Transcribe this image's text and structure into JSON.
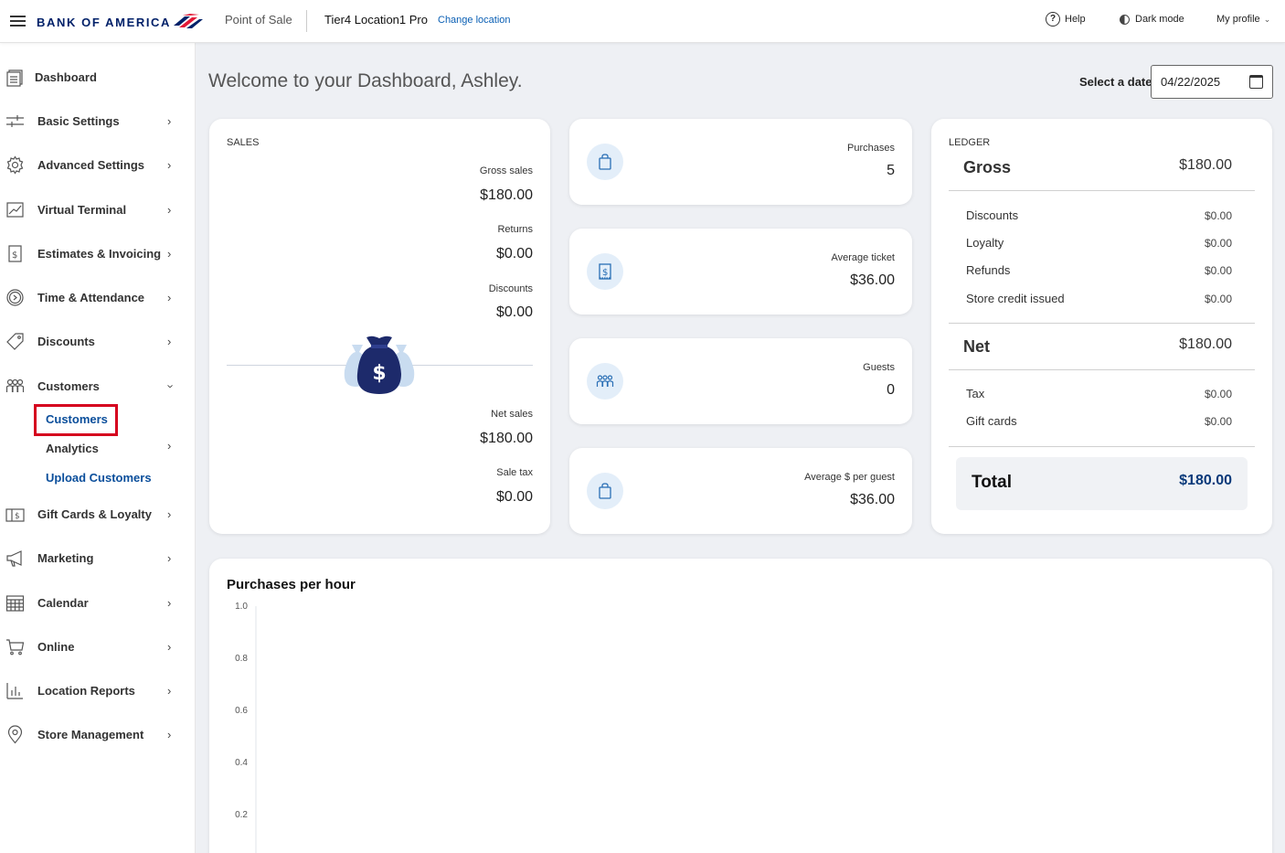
{
  "header": {
    "brand": "BANK OF AMERICA",
    "app_name": "Point of Sale",
    "location_name": "Tier4 Location1 Pro",
    "change_location": "Change location",
    "help": "Help",
    "dark_mode": "Dark mode",
    "my_profile": "My profile"
  },
  "sidebar": {
    "items": [
      {
        "label": "Dashboard",
        "icon": "dashboard-icon"
      },
      {
        "label": "Basic Settings",
        "icon": "sliders-icon"
      },
      {
        "label": "Advanced Settings",
        "icon": "gear-icon"
      },
      {
        "label": "Virtual Terminal",
        "icon": "terminal-icon"
      },
      {
        "label": "Estimates & Invoicing",
        "icon": "invoice-icon"
      },
      {
        "label": "Time & Attendance",
        "icon": "clock-icon"
      },
      {
        "label": "Discounts",
        "icon": "tag-icon"
      },
      {
        "label": "Customers",
        "icon": "people-icon"
      },
      {
        "label": "Gift Cards & Loyalty",
        "icon": "gift-card-icon"
      },
      {
        "label": "Marketing",
        "icon": "megaphone-icon"
      },
      {
        "label": "Calendar",
        "icon": "calendar-icon"
      },
      {
        "label": "Online",
        "icon": "cart-icon"
      },
      {
        "label": "Location Reports",
        "icon": "bar-chart-icon"
      },
      {
        "label": "Store Management",
        "icon": "location-pin-icon"
      }
    ],
    "customers_sub": {
      "customers": "Customers",
      "analytics": "Analytics",
      "upload_customers": "Upload Customers"
    }
  },
  "main": {
    "welcome": "Welcome to your Dashboard, Ashley.",
    "date_label": "Select a date",
    "date_value": "04/22/2025"
  },
  "sales": {
    "title": "SALES",
    "gross_label": "Gross sales",
    "gross_value": "$180.00",
    "returns_label": "Returns",
    "returns_value": "$0.00",
    "discounts_label": "Discounts",
    "discounts_value": "$0.00",
    "net_label": "Net sales",
    "net_value": "$180.00",
    "tax_label": "Sale tax",
    "tax_value": "$0.00"
  },
  "metrics": [
    {
      "label": "Purchases",
      "value": "5",
      "icon": "shopping-bag-icon"
    },
    {
      "label": "Average ticket",
      "value": "$36.00",
      "icon": "receipt-icon"
    },
    {
      "label": "Guests",
      "value": "0",
      "icon": "guests-icon"
    },
    {
      "label": "Average $ per guest",
      "value": "$36.00",
      "icon": "shopping-bag-icon"
    }
  ],
  "ledger": {
    "title": "LEDGER",
    "gross_label": "Gross",
    "gross_value": "$180.00",
    "discounts_label": "Discounts",
    "discounts_value": "$0.00",
    "loyalty_label": "Loyalty",
    "loyalty_value": "$0.00",
    "refunds_label": "Refunds",
    "refunds_value": "$0.00",
    "store_credit_label": "Store credit issued",
    "store_credit_value": "$0.00",
    "net_label": "Net",
    "net_value": "$180.00",
    "tax_label": "Tax",
    "tax_value": "$0.00",
    "gift_cards_label": "Gift cards",
    "gift_cards_value": "$0.00",
    "total_label": "Total",
    "total_value": "$180.00"
  },
  "chart_data": {
    "type": "bar",
    "title": "Purchases per hour",
    "y_ticks": [
      "1.0",
      "0.8",
      "0.6",
      "0.4",
      "0.2"
    ],
    "ylim": [
      0,
      1.0
    ],
    "categories": [],
    "values": []
  }
}
